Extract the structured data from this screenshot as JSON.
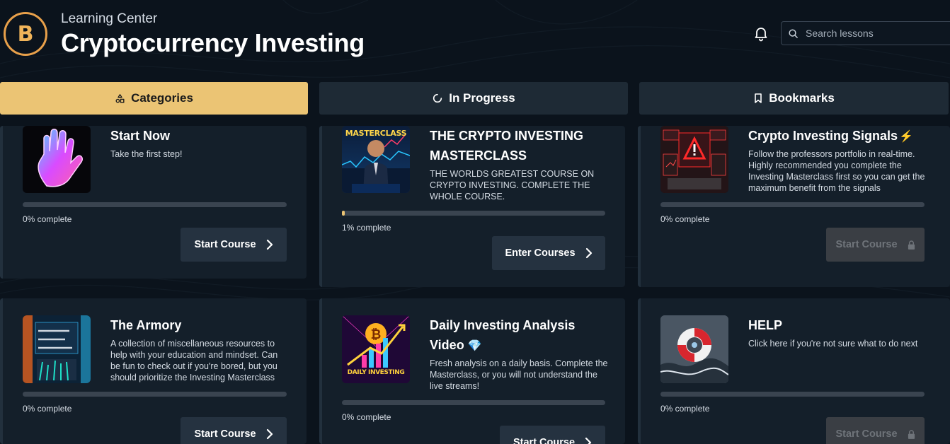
{
  "header": {
    "subtitle": "Learning Center",
    "title": "Cryptocurrency Investing",
    "logo_letter": "B",
    "search_placeholder": "Search lessons"
  },
  "tabs": [
    {
      "label": "Categories",
      "icon": "categories-icon",
      "active": true
    },
    {
      "label": "In Progress",
      "icon": "spinner-icon",
      "active": false
    },
    {
      "label": "Bookmarks",
      "icon": "bookmark-icon",
      "active": false
    }
  ],
  "colors": {
    "background": "#0b131c",
    "card": "#141f2a",
    "accent": "#ebc474",
    "logo": "#e8a04a"
  },
  "cards": [
    {
      "title": "Start Now",
      "description": "Take the first step!",
      "progress_percent": 0,
      "progress_label": "0% complete",
      "button_label": "Start Course",
      "button_icon": "chevron-right-icon",
      "locked": false,
      "thumbnail": "neon-hand-image"
    },
    {
      "title_line1": "THE CRYPTO INVESTING",
      "title_line2": "MASTERCLASS",
      "description": "THE WORLDS GREATEST COURSE ON CRYPTO INVESTING. COMPLETE THE WHOLE COURSE.",
      "progress_percent": 1,
      "progress_label": "1% complete",
      "button_label": "Enter Courses",
      "button_icon": "chevron-right-icon",
      "locked": false,
      "thumbnail": "masterclass-image",
      "thumbnail_text": "MASTERCLASS"
    },
    {
      "title": "Crypto Investing Signals",
      "title_emoji": "⚡",
      "description": "Follow the professors portfolio in real-time. Highly recommended you complete the Investing Masterclass first so you can get the maximum benefit from the signals",
      "progress_percent": 0,
      "progress_label": "0% complete",
      "button_label": "Start Course",
      "button_icon": "lock-icon",
      "locked": true,
      "thumbnail": "trading-alert-image"
    },
    {
      "title": "The Armory",
      "description": "A collection of miscellaneous resources to help with your education and mindset. Can be fun to check out if you're bored, but you should prioritize the Investing Masterclass",
      "progress_percent": 0,
      "progress_label": "0% complete",
      "button_label": "Start Course",
      "button_icon": "chevron-right-icon",
      "locked": false,
      "thumbnail": "armory-image"
    },
    {
      "title_line1": "Daily Investing Analysis",
      "title_line2": "Video",
      "title_emoji": "💎",
      "description": "Fresh analysis on a daily basis. Complete the Masterclass, or you will not understand the live streams!",
      "progress_percent": 0,
      "progress_label": "0% complete",
      "button_label": "Start Course",
      "button_icon": "chevron-right-icon",
      "locked": false,
      "thumbnail": "daily-investing-image",
      "thumbnail_text": "DAILY INVESTING"
    },
    {
      "title": "HELP",
      "description": "Click here if you're not sure what to do next",
      "progress_percent": 0,
      "progress_label": "0% complete",
      "button_label": "Start Course",
      "button_icon": "lock-icon",
      "locked": true,
      "thumbnail": "lifebuoy-image"
    }
  ]
}
